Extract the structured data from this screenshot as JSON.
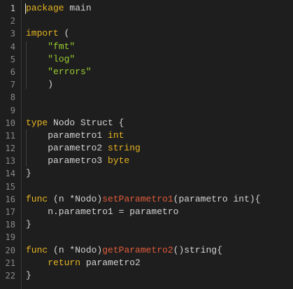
{
  "colors": {
    "background": "#1e1e1e",
    "default": "#d4d4d4",
    "keyword": "#e6b422",
    "type": "#e6b422",
    "string": "#9acd32",
    "function": "#e25c3c",
    "line_number": "#8a8a8a",
    "cursor": "#e6e6e6"
  },
  "editor": {
    "active_line": 1,
    "lines": [
      {
        "n": "1",
        "tokens": [
          {
            "t": "package",
            "k": "keyword"
          },
          {
            "t": " main",
            "k": "default"
          }
        ]
      },
      {
        "n": "2",
        "tokens": []
      },
      {
        "n": "3",
        "tokens": [
          {
            "t": "import",
            "k": "keyword"
          },
          {
            "t": " (",
            "k": "default"
          }
        ]
      },
      {
        "n": "4",
        "tokens": [
          {
            "t": "    ",
            "k": "default"
          },
          {
            "t": "\"fmt\"",
            "k": "string"
          }
        ]
      },
      {
        "n": "5",
        "tokens": [
          {
            "t": "    ",
            "k": "default"
          },
          {
            "t": "\"log\"",
            "k": "string"
          }
        ]
      },
      {
        "n": "6",
        "tokens": [
          {
            "t": "    ",
            "k": "default"
          },
          {
            "t": "\"errors\"",
            "k": "string"
          }
        ]
      },
      {
        "n": "7",
        "tokens": [
          {
            "t": "    )",
            "k": "default"
          }
        ]
      },
      {
        "n": "8",
        "tokens": []
      },
      {
        "n": "9",
        "tokens": []
      },
      {
        "n": "10",
        "tokens": [
          {
            "t": "type",
            "k": "keyword"
          },
          {
            "t": " Nodo Struct {",
            "k": "default"
          }
        ]
      },
      {
        "n": "11",
        "tokens": [
          {
            "t": "    parametro1 ",
            "k": "default"
          },
          {
            "t": "int",
            "k": "type"
          }
        ]
      },
      {
        "n": "12",
        "tokens": [
          {
            "t": "    parametro2 ",
            "k": "default"
          },
          {
            "t": "string",
            "k": "type"
          }
        ]
      },
      {
        "n": "13",
        "tokens": [
          {
            "t": "    parametro3 ",
            "k": "default"
          },
          {
            "t": "byte",
            "k": "type"
          }
        ]
      },
      {
        "n": "14",
        "tokens": [
          {
            "t": "}",
            "k": "default"
          }
        ]
      },
      {
        "n": "15",
        "tokens": []
      },
      {
        "n": "16",
        "tokens": [
          {
            "t": "func",
            "k": "keyword"
          },
          {
            "t": " (n *Nodo)",
            "k": "default"
          },
          {
            "t": "setParametro1",
            "k": "function"
          },
          {
            "t": "(parametro int){",
            "k": "default"
          }
        ]
      },
      {
        "n": "17",
        "tokens": [
          {
            "t": "    n.parametro1 = parametro",
            "k": "default"
          }
        ]
      },
      {
        "n": "18",
        "tokens": [
          {
            "t": "}",
            "k": "default"
          }
        ]
      },
      {
        "n": "19",
        "tokens": []
      },
      {
        "n": "20",
        "tokens": [
          {
            "t": "func",
            "k": "keyword"
          },
          {
            "t": " (n *Nodo)",
            "k": "default"
          },
          {
            "t": "getParametro2",
            "k": "function"
          },
          {
            "t": "()string{",
            "k": "default"
          }
        ]
      },
      {
        "n": "21",
        "tokens": [
          {
            "t": "    ",
            "k": "default"
          },
          {
            "t": "return",
            "k": "keyword"
          },
          {
            "t": " parametro2",
            "k": "default"
          }
        ]
      },
      {
        "n": "22",
        "tokens": [
          {
            "t": "}",
            "k": "default"
          }
        ]
      }
    ]
  }
}
